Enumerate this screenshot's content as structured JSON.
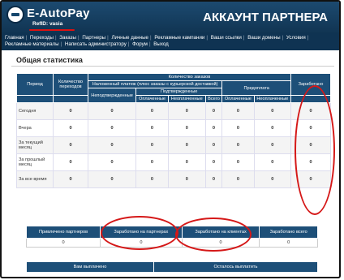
{
  "header": {
    "brand": "E-AutoPay",
    "refid": "RefID: vasia",
    "title": "АККАУНТ ПАРТНЕРА"
  },
  "nav": {
    "items": [
      "Главная",
      "Переходы",
      "Заказы",
      "Партнеры",
      "Личные данные",
      "Рекламные кампании",
      "Ваши ссылки",
      "Ваши домены",
      "Условия",
      "Рекламные материалы",
      "Написать администратору",
      "Форум",
      "Выход"
    ]
  },
  "stats": {
    "title": "Общая статистика",
    "headers": {
      "period": "Период",
      "transitions": "Количество переходов",
      "orders_count": "Количество заказов",
      "cod": "Наложенный платеж (плюс заказы с курьерской доставкой)",
      "unconfirmed": "Неподтвержденные",
      "confirmed": "Подтвержденные",
      "paid": "Оплаченные",
      "unpaid": "Неоплаченные",
      "total": "Всего",
      "prepay": "Предоплата",
      "earned": "Заработано"
    },
    "rows": [
      {
        "period": "Сегодня",
        "transitions": "0",
        "unconfirmed": "0",
        "paid": "0",
        "unpaid": "0",
        "total": "0",
        "prepaid": "0",
        "prepay_unpaid": "0",
        "earned": "0"
      },
      {
        "period": "Вчера",
        "transitions": "0",
        "unconfirmed": "0",
        "paid": "0",
        "unpaid": "0",
        "total": "0",
        "prepaid": "0",
        "prepay_unpaid": "0",
        "earned": "0"
      },
      {
        "period": "За текущий месяц",
        "transitions": "0",
        "unconfirmed": "0",
        "paid": "0",
        "unpaid": "0",
        "total": "0",
        "prepaid": "0",
        "prepay_unpaid": "0",
        "earned": "0"
      },
      {
        "period": "За прошлый месяц",
        "transitions": "0",
        "unconfirmed": "0",
        "paid": "0",
        "unpaid": "0",
        "total": "0",
        "prepaid": "0",
        "prepay_unpaid": "0",
        "earned": "0"
      },
      {
        "period": "За все время",
        "transitions": "0",
        "unconfirmed": "0",
        "paid": "0",
        "unpaid": "0",
        "total": "0",
        "prepaid": "0",
        "prepay_unpaid": "0",
        "earned": "0"
      }
    ]
  },
  "summary": {
    "headers": [
      "Привлечено партнеров",
      "Заработано на партнерах",
      "Заработано на клиентах",
      "Заработано всего"
    ],
    "values": [
      "0",
      "0",
      "0",
      "0"
    ]
  },
  "payouts": {
    "headers": [
      "Вам выплачено",
      "Осталось выплатить"
    ]
  },
  "colors": {
    "header": "#1d4f78",
    "nav": "#0f3352",
    "red": "#c01616",
    "green": "#149a14",
    "annotation": "#d51818"
  }
}
